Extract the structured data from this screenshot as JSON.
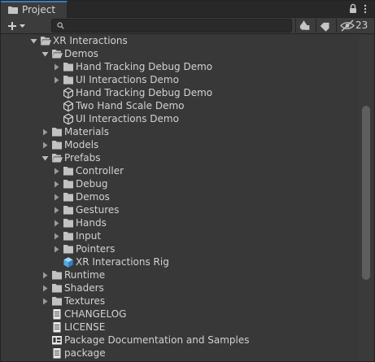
{
  "window": {
    "tab_title": "Project"
  },
  "toolbar": {
    "search_placeholder": "",
    "hidden_packages_count": "23"
  },
  "tree": [
    {
      "label": "XR Interactions",
      "icon": "folder-open-icon",
      "arrow": "expanded",
      "depth": 0
    },
    {
      "label": "Demos",
      "icon": "folder-open-icon",
      "arrow": "expanded",
      "depth": 1
    },
    {
      "label": "Hand Tracking Debug Demo",
      "icon": "folder-icon",
      "arrow": "collapsed",
      "depth": 2
    },
    {
      "label": "UI Interactions Demo",
      "icon": "folder-icon",
      "arrow": "collapsed",
      "depth": 2
    },
    {
      "label": "Hand Tracking Debug Demo",
      "icon": "unity-scene-icon",
      "arrow": "none",
      "depth": 2
    },
    {
      "label": "Two Hand Scale Demo",
      "icon": "unity-scene-icon",
      "arrow": "none",
      "depth": 2
    },
    {
      "label": "UI Interactions Demo",
      "icon": "unity-scene-icon",
      "arrow": "none",
      "depth": 2
    },
    {
      "label": "Materials",
      "icon": "folder-icon",
      "arrow": "collapsed",
      "depth": 1
    },
    {
      "label": "Models",
      "icon": "folder-icon",
      "arrow": "collapsed",
      "depth": 1
    },
    {
      "label": "Prefabs",
      "icon": "folder-open-icon",
      "arrow": "expanded",
      "depth": 1
    },
    {
      "label": "Controller",
      "icon": "folder-icon",
      "arrow": "collapsed",
      "depth": 2
    },
    {
      "label": "Debug",
      "icon": "folder-icon",
      "arrow": "collapsed",
      "depth": 2
    },
    {
      "label": "Demos",
      "icon": "folder-icon",
      "arrow": "collapsed",
      "depth": 2
    },
    {
      "label": "Gestures",
      "icon": "folder-icon",
      "arrow": "collapsed",
      "depth": 2
    },
    {
      "label": "Hands",
      "icon": "folder-icon",
      "arrow": "collapsed",
      "depth": 2
    },
    {
      "label": "Input",
      "icon": "folder-icon",
      "arrow": "collapsed",
      "depth": 2
    },
    {
      "label": "Pointers",
      "icon": "folder-icon",
      "arrow": "collapsed",
      "depth": 2
    },
    {
      "label": "XR Interactions Rig",
      "icon": "prefab-icon",
      "arrow": "none",
      "depth": 2
    },
    {
      "label": "Runtime",
      "icon": "folder-icon",
      "arrow": "collapsed",
      "depth": 1
    },
    {
      "label": "Shaders",
      "icon": "folder-icon",
      "arrow": "collapsed",
      "depth": 1
    },
    {
      "label": "Textures",
      "icon": "folder-icon",
      "arrow": "collapsed",
      "depth": 1
    },
    {
      "label": "CHANGELOG",
      "icon": "text-file-icon",
      "arrow": "none",
      "depth": 1
    },
    {
      "label": "LICENSE",
      "icon": "text-file-icon",
      "arrow": "none",
      "depth": 1
    },
    {
      "label": "Package Documentation and Samples",
      "icon": "pdf-document-icon",
      "arrow": "none",
      "depth": 1
    },
    {
      "label": "package",
      "icon": "text-file-icon",
      "arrow": "none",
      "depth": 1
    }
  ]
}
